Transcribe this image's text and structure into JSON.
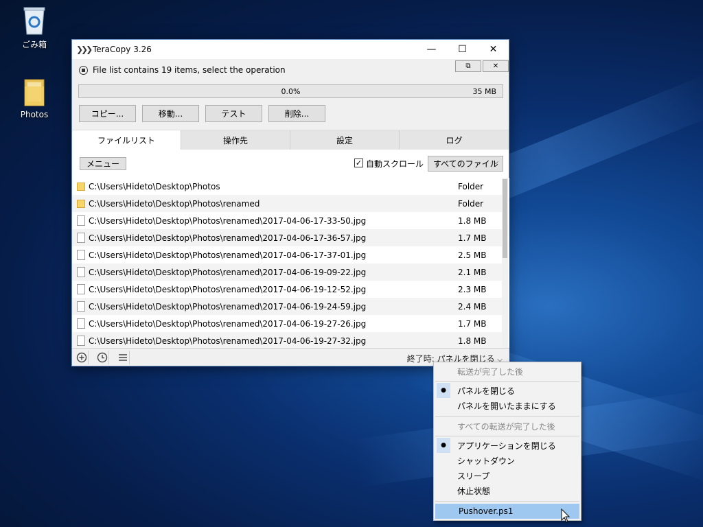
{
  "desktop": {
    "icons": [
      {
        "label": "ごみ箱"
      },
      {
        "label": "Photos"
      }
    ]
  },
  "window": {
    "title": "TeraCopy 3.26",
    "status_text": "File list contains 19 items, select the operation",
    "progress": {
      "percent_label": "0.0%",
      "size_label": "35 MB",
      "fraction": 0.0
    },
    "buttons": {
      "copy": "コピー...",
      "move": "移動...",
      "test": "テスト",
      "delete": "削除..."
    },
    "tabs": [
      {
        "label": "ファイルリスト",
        "active": true
      },
      {
        "label": "操作先",
        "active": false
      },
      {
        "label": "設定",
        "active": false
      },
      {
        "label": "ログ",
        "active": false
      }
    ],
    "menu_button": "メニュー",
    "autoscroll": {
      "label": "自動スクロール",
      "checked": true
    },
    "filter_select": {
      "value": "すべてのファイル"
    },
    "files": [
      {
        "type": "folder",
        "path": "C:\\Users\\Hideto\\Desktop\\Photos",
        "size": "Folder"
      },
      {
        "type": "folder",
        "path": "C:\\Users\\Hideto\\Desktop\\Photos\\renamed",
        "size": "Folder"
      },
      {
        "type": "file",
        "path": "C:\\Users\\Hideto\\Desktop\\Photos\\renamed\\2017-04-06-17-33-50.jpg",
        "size": "1.8 MB"
      },
      {
        "type": "file",
        "path": "C:\\Users\\Hideto\\Desktop\\Photos\\renamed\\2017-04-06-17-36-57.jpg",
        "size": "1.7 MB"
      },
      {
        "type": "file",
        "path": "C:\\Users\\Hideto\\Desktop\\Photos\\renamed\\2017-04-06-17-37-01.jpg",
        "size": "2.5 MB"
      },
      {
        "type": "file",
        "path": "C:\\Users\\Hideto\\Desktop\\Photos\\renamed\\2017-04-06-19-09-22.jpg",
        "size": "2.1 MB"
      },
      {
        "type": "file",
        "path": "C:\\Users\\Hideto\\Desktop\\Photos\\renamed\\2017-04-06-19-12-52.jpg",
        "size": "2.3 MB"
      },
      {
        "type": "file",
        "path": "C:\\Users\\Hideto\\Desktop\\Photos\\renamed\\2017-04-06-19-24-59.jpg",
        "size": "2.4 MB"
      },
      {
        "type": "file",
        "path": "C:\\Users\\Hideto\\Desktop\\Photos\\renamed\\2017-04-06-19-27-26.jpg",
        "size": "1.7 MB"
      },
      {
        "type": "file",
        "path": "C:\\Users\\Hideto\\Desktop\\Photos\\renamed\\2017-04-06-19-27-32.jpg",
        "size": "1.8 MB"
      }
    ],
    "after_completion_label": "終了時: パネルを閉じる"
  },
  "popup_menu": {
    "header_1": "転送が完了した後",
    "close_panel": "パネルを閉じる",
    "keep_panel_open": "パネルを開いたままにする",
    "header_2": "すべての転送が完了した後",
    "close_app": "アプリケーションを閉じる",
    "shutdown": "シャットダウン",
    "sleep": "スリープ",
    "hibernate": "休止状態",
    "script": "Pushover.ps1"
  },
  "colors": {
    "accent_selection": "#9ec8f0",
    "folder": "#f7d568",
    "desktop_bg": "#0a2f6e"
  }
}
